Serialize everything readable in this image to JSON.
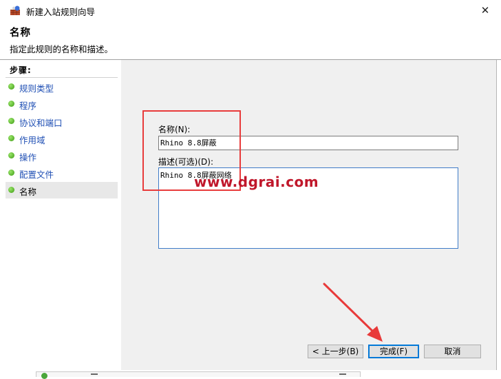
{
  "window": {
    "title": "新建入站规则向导",
    "close_glyph": "✕"
  },
  "header": {
    "title": "名称",
    "subtitle": "指定此规则的名称和描述。"
  },
  "steps": {
    "heading": "步骤:",
    "items": [
      {
        "label": "规则类型"
      },
      {
        "label": "程序"
      },
      {
        "label": "协议和端口"
      },
      {
        "label": "作用域"
      },
      {
        "label": "操作"
      },
      {
        "label": "配置文件"
      },
      {
        "label": "名称",
        "current": true
      }
    ]
  },
  "form": {
    "name_label": "名称(N):",
    "name_value": "Rhino 8.8屏蔽",
    "desc_label": "描述(可选)(D):",
    "desc_value": "Rhino 8.8屏蔽网络"
  },
  "buttons": {
    "back": "< 上一步(B)",
    "finish": "完成(F)",
    "cancel": "取消"
  },
  "watermark": "www.dgrai.com",
  "colors": {
    "annotation_red": "#e83a3a",
    "watermark": "#c0172b",
    "link_blue": "#1f4fb4"
  }
}
